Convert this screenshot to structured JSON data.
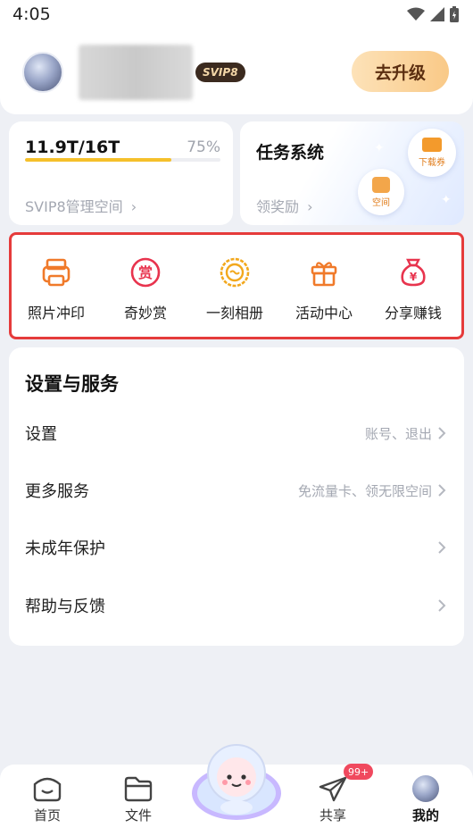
{
  "status_bar": {
    "time": "4:05"
  },
  "header": {
    "vip_badge": "SVIP8",
    "upgrade_label": "去升级"
  },
  "storage": {
    "used": "11.9T/16T",
    "percent_label": "75%",
    "percent": 0.75,
    "manage_label": "SVIP8管理空间"
  },
  "task": {
    "title": "任务系统",
    "link_label": "领奖励",
    "coupon_label": "下载券",
    "space_label": "空间"
  },
  "quick_actions": [
    {
      "label": "照片冲印",
      "icon": "photo-print-icon",
      "color": "#f07a2a"
    },
    {
      "label": "奇妙赏",
      "icon": "reward-icon",
      "color": "#e8344e",
      "glyph": "赏"
    },
    {
      "label": "一刻相册",
      "icon": "moment-album-icon",
      "color": "#f2a81d"
    },
    {
      "label": "活动中心",
      "icon": "gift-icon",
      "color": "#f07a2a"
    },
    {
      "label": "分享赚钱",
      "icon": "money-bag-icon",
      "color": "#e8344e",
      "glyph": "¥"
    }
  ],
  "settings": {
    "title": "设置与服务",
    "rows": [
      {
        "label": "设置",
        "hint": "账号、退出"
      },
      {
        "label": "更多服务",
        "hint": "免流量卡、领无限空间"
      },
      {
        "label": "未成年保护",
        "hint": ""
      },
      {
        "label": "帮助与反馈",
        "hint": ""
      }
    ]
  },
  "tabs": {
    "home": "首页",
    "files": "文件",
    "share": "共享",
    "mine": "我的",
    "share_badge": "99+"
  },
  "colors": {
    "accent_yellow": "#f5c02b",
    "highlight_border": "#e53b3b",
    "badge_red": "#f0495e"
  }
}
